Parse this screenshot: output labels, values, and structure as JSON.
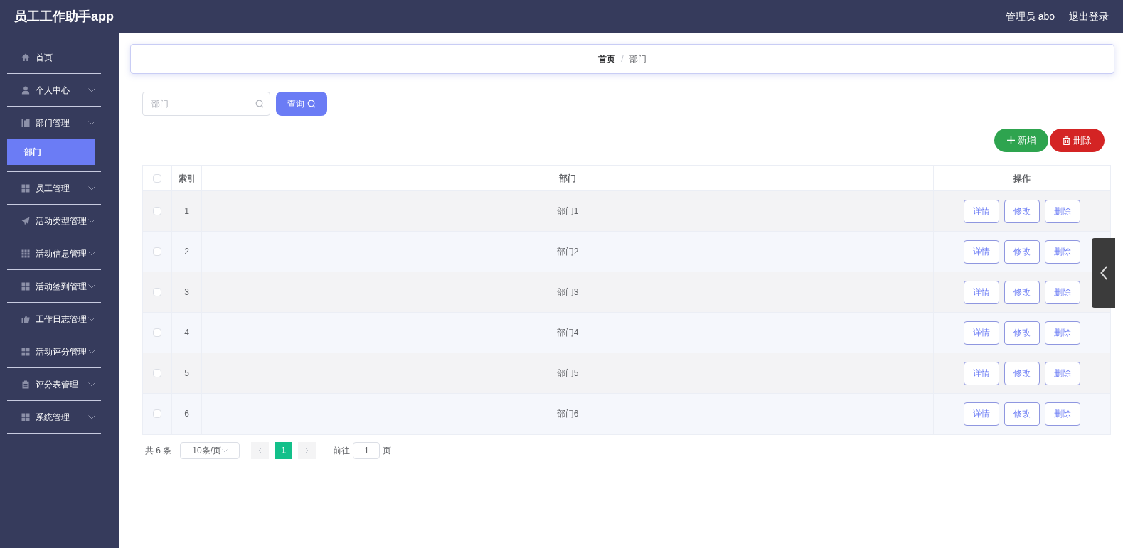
{
  "app_title": "员工工作助手app",
  "header_user": "管理员 abo",
  "logout": "退出登录",
  "sidebar": {
    "items": [
      {
        "label": "首页",
        "kind": "link",
        "selected": false
      },
      {
        "label": "个人中心",
        "kind": "submenu",
        "selected": false
      },
      {
        "label": "部门管理",
        "kind": "submenu",
        "selected": false,
        "children": [
          {
            "label": "部门",
            "selected": true
          }
        ]
      },
      {
        "label": "员工管理",
        "kind": "submenu",
        "selected": false
      },
      {
        "label": "活动类型管理",
        "kind": "submenu",
        "selected": false
      },
      {
        "label": "活动信息管理",
        "kind": "submenu",
        "selected": false
      },
      {
        "label": "活动签到管理",
        "kind": "submenu",
        "selected": false
      },
      {
        "label": "工作日志管理",
        "kind": "submenu",
        "selected": false
      },
      {
        "label": "活动评分管理",
        "kind": "submenu",
        "selected": false
      },
      {
        "label": "评分表管理",
        "kind": "submenu",
        "selected": false
      },
      {
        "label": "系统管理",
        "kind": "submenu",
        "selected": false
      }
    ]
  },
  "breadcrumb": [
    "首页",
    "部门"
  ],
  "breadcrumb_separator": "/",
  "search": {
    "placeholder": "部门",
    "button": "查询"
  },
  "actions": {
    "add": "新增",
    "delete": "删除"
  },
  "table": {
    "columns": [
      "索引",
      "部门",
      "操作"
    ],
    "header_checked": false,
    "rows": [
      {
        "index": "1",
        "name": "部门1",
        "checked": false,
        "actions": [
          "详情",
          "修改",
          "删除"
        ]
      },
      {
        "index": "2",
        "name": "部门2",
        "checked": false,
        "actions": [
          "详情",
          "修改",
          "删除"
        ]
      },
      {
        "index": "3",
        "name": "部门3",
        "checked": false,
        "actions": [
          "详情",
          "修改",
          "删除"
        ]
      },
      {
        "index": "4",
        "name": "部门4",
        "checked": false,
        "actions": [
          "详情",
          "修改",
          "删除"
        ]
      },
      {
        "index": "5",
        "name": "部门5",
        "checked": false,
        "actions": [
          "详情",
          "修改",
          "删除"
        ]
      },
      {
        "index": "6",
        "name": "部门6",
        "checked": false,
        "actions": [
          "详情",
          "修改",
          "删除"
        ]
      }
    ]
  },
  "pagination": {
    "total": "共 6 条",
    "page_size": "10条/页",
    "pages": [
      {
        "label": "1",
        "selected": true
      }
    ],
    "goto_label": "前往",
    "goto_value": "1",
    "goto_suffix": "页"
  }
}
